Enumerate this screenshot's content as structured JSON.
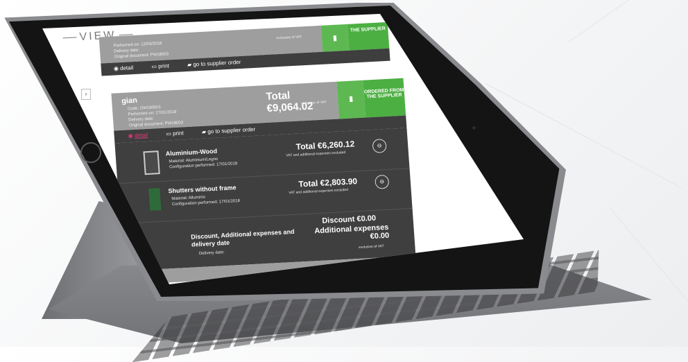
{
  "logo": {
    "text": "VIEW"
  },
  "order_previous": {
    "meta": [
      "Performed on: 12/03/2018",
      "Delivery date:",
      "Original document: PW18003"
    ],
    "excl_label": "exclusive of VAT",
    "status": "THE SUPPLIER",
    "actions": {
      "detail": "detail",
      "print": "print",
      "supplier_order": "go to supplier order"
    }
  },
  "order_current": {
    "name": "gian",
    "meta": [
      "Code: OW180001",
      "Performed on: 17/01/2018",
      "Delivery date:",
      "Original document: PW18003"
    ],
    "total": "Total €9,064.02",
    "excl_label": "exclusive of VAT",
    "status_line1": "ORDERED FROM",
    "status_line2": "THE SUPPLIER",
    "actions": {
      "detail": "detail",
      "print": "print",
      "supplier_order": "go to supplier order"
    },
    "items": [
      {
        "title": "Aluminium-Wood",
        "material": "Material: Aluminium/Legno",
        "config": "Configuration performed: 17/01/2018",
        "total": "Total €6,260.12",
        "note": "VAT and additional expenses excluded"
      },
      {
        "title": "Shutters without frame",
        "material": "Material: Alluminio",
        "config": "Configuration performed: 17/01/2018",
        "total": "Total €2,803.90",
        "note": "VAT and additional expenses excluded"
      }
    ],
    "summary": {
      "title": "Discount, Additional expenses and delivery date",
      "delivery": "Delivery date:",
      "discount": "Discount €0.00",
      "additional": "Additional expenses €0.00",
      "excl": "exclusive of VAT"
    }
  },
  "colors": {
    "accent_green": "#4caf42",
    "panel_dark": "#3f3f3f",
    "header_grey": "#9e9e9e",
    "detail_pink": "#e5397a"
  }
}
